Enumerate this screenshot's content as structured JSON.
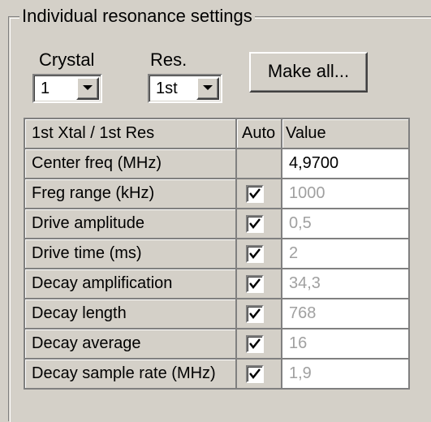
{
  "group": {
    "title": "Individual resonance settings"
  },
  "crystal": {
    "label": "Crystal",
    "value": "1"
  },
  "res": {
    "label": "Res.",
    "value": "1st"
  },
  "make_all_button": "Make all...",
  "icons": {
    "dropdown": "chevron-down-icon",
    "check": "checkmark-icon"
  },
  "table": {
    "headers": [
      "1st Xtal / 1st Res",
      "Auto",
      "Value"
    ],
    "rows": [
      {
        "label": "Center freq (MHz)",
        "auto": false,
        "value": "4,9700"
      },
      {
        "label": "Freg range (kHz)",
        "auto": true,
        "value": "1000"
      },
      {
        "label": "Drive amplitude",
        "auto": true,
        "value": "0,5"
      },
      {
        "label": "Drive time (ms)",
        "auto": true,
        "value": "2"
      },
      {
        "label": "Decay amplification",
        "auto": true,
        "value": "34,3"
      },
      {
        "label": "Decay length",
        "auto": true,
        "value": "768"
      },
      {
        "label": "Decay average",
        "auto": true,
        "value": "16"
      },
      {
        "label": "Decay sample rate (MHz)",
        "auto": true,
        "value": "1,9"
      }
    ]
  },
  "colors": {
    "face": "#d4d0c8",
    "shadow": "#808080",
    "disabled_text": "#a0a0a0"
  }
}
